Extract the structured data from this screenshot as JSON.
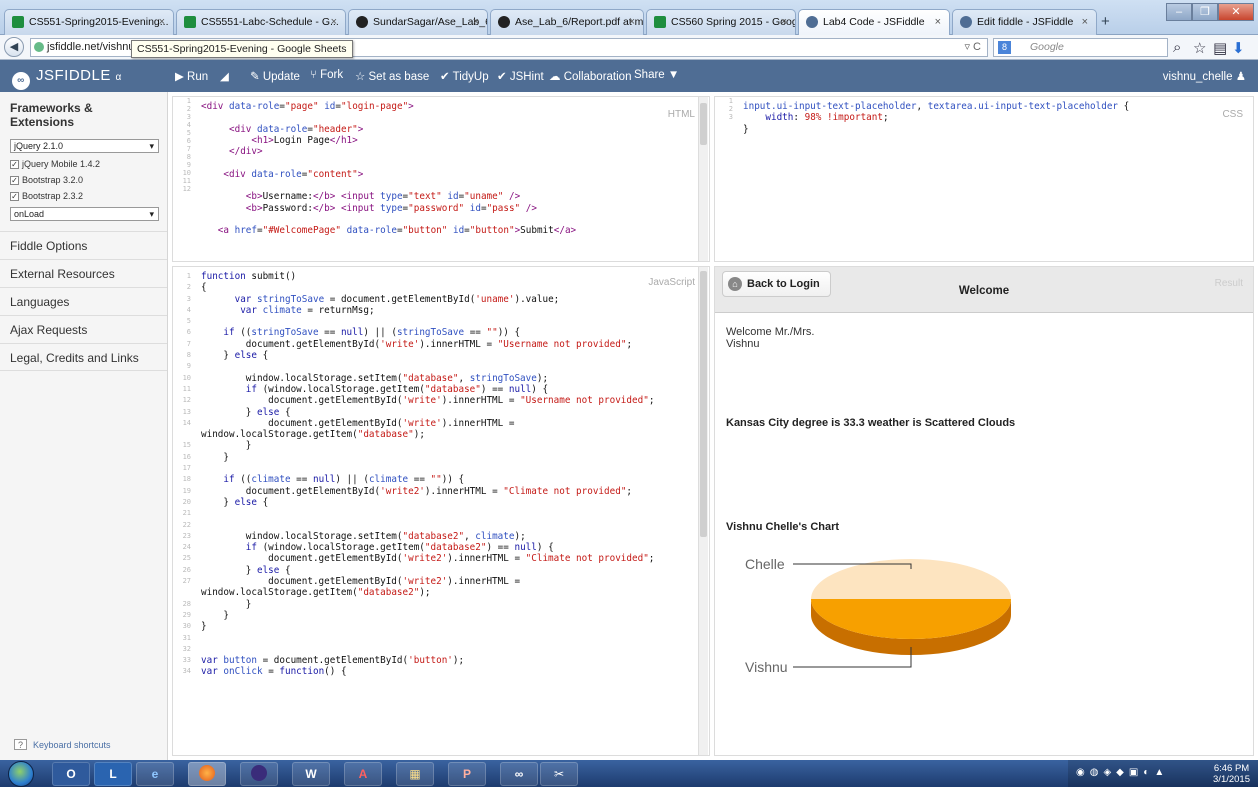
{
  "browser": {
    "tabs": [
      {
        "title": "CS551-Spring2015-Evening...",
        "icon_color": "#1e8e3e"
      },
      {
        "title": "CS5551-Labc-Schedule - G...",
        "icon_color": "#1e8e3e"
      },
      {
        "title": "SundarSagar/Ase_Lab_6",
        "icon_color": "#222222"
      },
      {
        "title": "Ase_Lab_6/Report.pdf at m...",
        "icon_color": "#222222"
      },
      {
        "title": "CS560 Spring 2015 - Googl...",
        "icon_color": "#1e8e3e"
      },
      {
        "title": "Lab4 Code - JSFiddle",
        "icon_color": "#4f6d94"
      },
      {
        "title": "Edit fiddle - JSFiddle",
        "icon_color": "#4f6d94"
      }
    ],
    "active_tab_index": 5,
    "url": "jsfiddle.net/vishnu_",
    "tooltip": "CS551-Spring2015-Evening - Google Sheets",
    "search_placeholder": "Google"
  },
  "jsfiddle": {
    "logo": "JSFIDDLE",
    "logo_suffix": "α",
    "toolbar": {
      "run": "▶ Run",
      "update": "✎ Update",
      "fork": "⑂ Fork",
      "set_as_base": "☆ Set as base",
      "tidyup": "✔ TidyUp",
      "jshint": "✔ JSHint",
      "collaboration": "☁ Collaboration",
      "share": "Share ▼"
    },
    "user": "vishnu_chelle"
  },
  "sidebar": {
    "heading": "Frameworks & Extensions",
    "framework": "jQuery 2.1.0",
    "extensions": [
      "jQuery Mobile 1.4.2",
      "Bootstrap 3.2.0",
      "Bootstrap 2.3.2"
    ],
    "load": "onLoad",
    "items": [
      "Fiddle Options",
      "External Resources",
      "Languages",
      "Ajax Requests",
      "Legal, Credits and Links"
    ],
    "keyboard": "Keyboard shortcuts"
  },
  "panels": {
    "html_label": "HTML",
    "css_label": "CSS",
    "js_label": "JavaScript",
    "result_label": "Result"
  },
  "result": {
    "back_button": "Back to Login",
    "title": "Welcome",
    "welcome_line1": "Welcome Mr./Mrs.",
    "welcome_line2": "Vishnu",
    "weather": "Kansas City degree is 33.3 weather is Scattered Clouds",
    "chart_title": "Vishnu Chelle's Chart"
  },
  "chart_data": {
    "type": "pie",
    "categories": [
      "Chelle",
      "Vishnu"
    ],
    "values": [
      50,
      50
    ],
    "colors": [
      "#fde4c0",
      "#f7a000"
    ]
  },
  "taskbar": {
    "time": "6:46 PM",
    "date": "3/1/2015"
  }
}
